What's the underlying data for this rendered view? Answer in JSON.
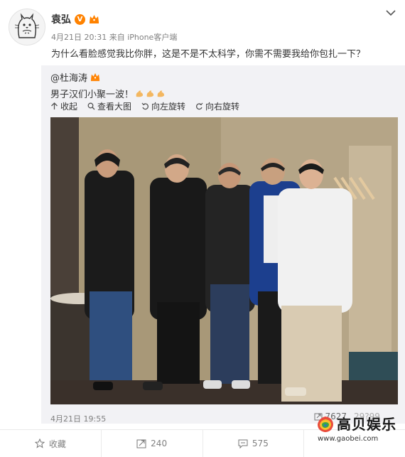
{
  "post": {
    "author": "袁弘",
    "date": "4月21日 20:31",
    "source": "来自 iPhone客户端",
    "text": "为什么看脸感觉我比你胖，这是不是不太科学，你需不需要我给你包扎一下？"
  },
  "repost": {
    "user": "@杜海涛",
    "text": "男子汉们小聚一波！",
    "toolbar": {
      "collapse": "收起",
      "view_large": "查看大图",
      "rotate_left": "向左旋转",
      "rotate_right": "向右旋转"
    },
    "date": "4月21日 19:55",
    "forwards": "7627",
    "likes_partial": "29?99"
  },
  "actions": {
    "favorite": "收藏",
    "forward": "240",
    "comment": "575",
    "like": ""
  },
  "watermark": {
    "title": "高贝娱乐",
    "url": "www.gaobei.com"
  },
  "colors": {
    "badge_orange": "#ff8200",
    "repost_bg": "#f2f2f5",
    "meta_gray": "#808080"
  }
}
